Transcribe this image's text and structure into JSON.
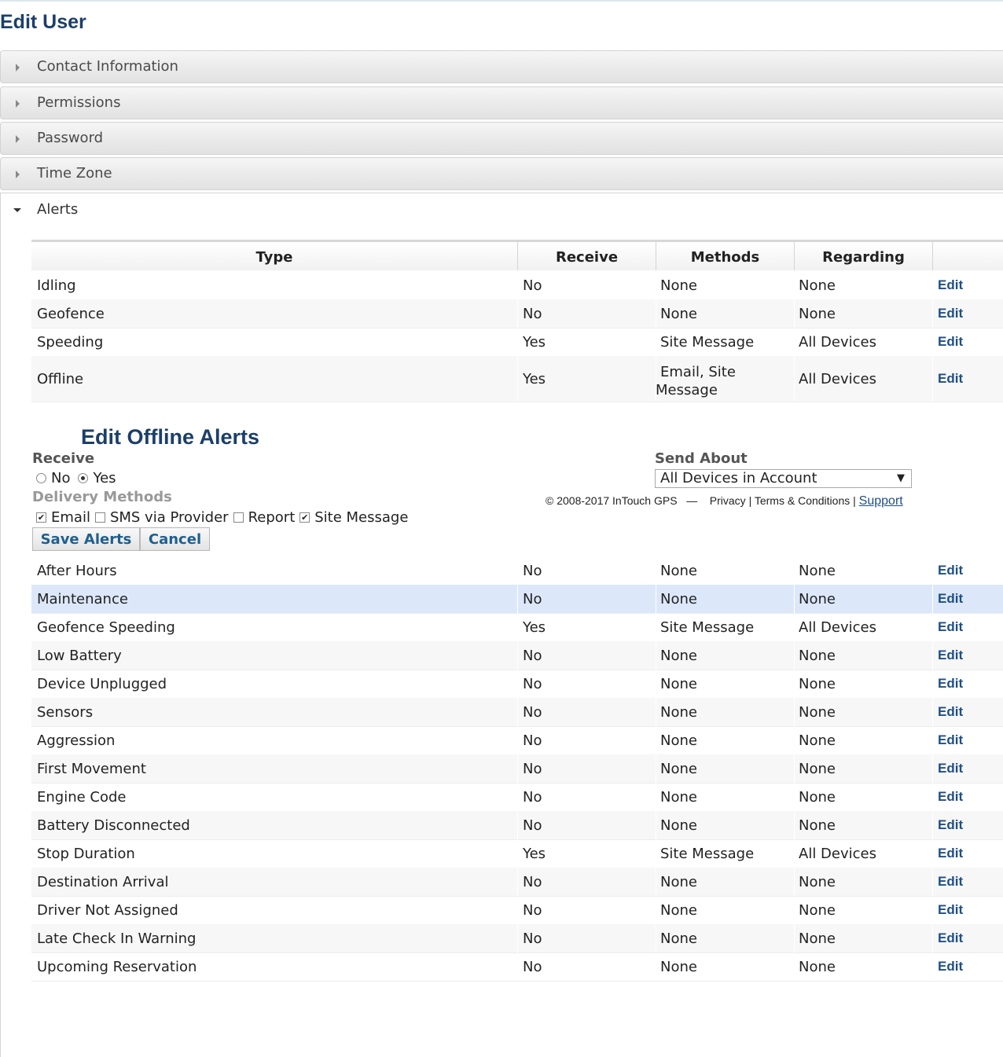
{
  "page": {
    "title": "Edit User"
  },
  "accordion": {
    "sections": [
      {
        "label": "Contact Information"
      },
      {
        "label": "Permissions"
      },
      {
        "label": "Password"
      },
      {
        "label": "Time Zone"
      },
      {
        "label": "Alerts"
      }
    ]
  },
  "alerts_table": {
    "headers": {
      "type": "Type",
      "receive": "Receive",
      "methods": "Methods",
      "regarding": "Regarding"
    },
    "edit_label": "Edit",
    "rows_top": [
      {
        "type": "Idling",
        "receive": "No",
        "methods": "None",
        "regarding": "None"
      },
      {
        "type": "Geofence",
        "receive": "No",
        "methods": "None",
        "regarding": "None"
      },
      {
        "type": "Speeding",
        "receive": "Yes",
        "methods": "Site Message",
        "regarding": "All Devices"
      },
      {
        "type": "Offline",
        "receive": "Yes",
        "methods_line1": "Email, Site",
        "methods_line2": "Message",
        "regarding": "All Devices"
      }
    ],
    "rows_bottom": [
      {
        "type": "After Hours",
        "receive": "No",
        "methods": "None",
        "regarding": "None"
      },
      {
        "type": "Maintenance",
        "receive": "No",
        "methods": "None",
        "regarding": "None"
      },
      {
        "type": "Geofence Speeding",
        "receive": "Yes",
        "methods": "Site Message",
        "regarding": "All Devices"
      },
      {
        "type": "Low Battery",
        "receive": "No",
        "methods": "None",
        "regarding": "None"
      },
      {
        "type": "Device Unplugged",
        "receive": "No",
        "methods": "None",
        "regarding": "None"
      },
      {
        "type": "Sensors",
        "receive": "No",
        "methods": "None",
        "regarding": "None"
      },
      {
        "type": "Aggression",
        "receive": "No",
        "methods": "None",
        "regarding": "None"
      },
      {
        "type": "First Movement",
        "receive": "No",
        "methods": "None",
        "regarding": "None"
      },
      {
        "type": "Engine Code",
        "receive": "No",
        "methods": "None",
        "regarding": "None"
      },
      {
        "type": "Battery Disconnected",
        "receive": "No",
        "methods": "None",
        "regarding": "None"
      },
      {
        "type": "Stop Duration",
        "receive": "Yes",
        "methods": "Site Message",
        "regarding": "All Devices"
      },
      {
        "type": "Destination Arrival",
        "receive": "No",
        "methods": "None",
        "regarding": "None"
      },
      {
        "type": "Driver Not Assigned",
        "receive": "No",
        "methods": "None",
        "regarding": "None"
      },
      {
        "type": "Late Check In Warning",
        "receive": "No",
        "methods": "None",
        "regarding": "None"
      },
      {
        "type": "Upcoming Reservation",
        "receive": "No",
        "methods": "None",
        "regarding": "None"
      }
    ],
    "highlighted_row": "Maintenance"
  },
  "edit_panel": {
    "title": "Edit Offline Alerts",
    "receive_label": "Receive",
    "receive_options": {
      "no": "No",
      "yes": "Yes"
    },
    "receive_selected": "Yes",
    "send_about_label": "Send About",
    "send_about_value": "All Devices in Account",
    "delivery_label": "Delivery Methods",
    "delivery": {
      "email": {
        "label": "Email",
        "checked": true
      },
      "sms": {
        "label": "SMS via Provider",
        "checked": false
      },
      "report": {
        "label": "Report",
        "checked": false
      },
      "site_message": {
        "label": "Site Message",
        "checked": true
      }
    },
    "save_label": "Save Alerts",
    "cancel_label": "Cancel"
  },
  "footer": {
    "copyright": "© 2008-2017 InTouch GPS",
    "dash": "—",
    "privacy": "Privacy",
    "sep": "|",
    "terms": "Terms & Conditions",
    "support": "Support"
  },
  "colors": {
    "heading": "#1b3f6b",
    "link": "#1f4f85",
    "highlight_row": "#dce8fa"
  }
}
